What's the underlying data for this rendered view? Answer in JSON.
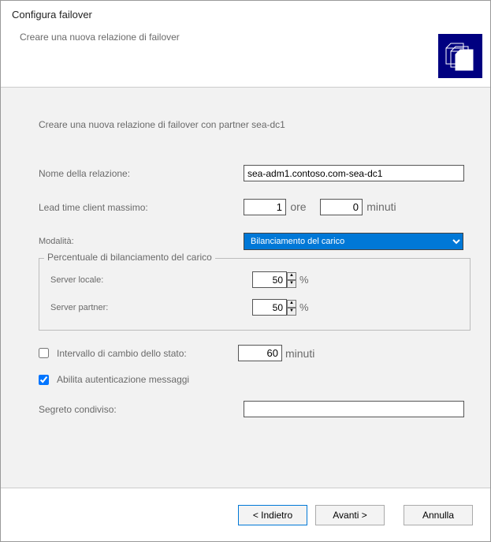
{
  "header": {
    "title": "Configura failover",
    "subtitle": "Creare una nuova relazione di failover"
  },
  "body": {
    "intro": "Creare una nuova relazione di failover con partner sea-dc1",
    "relation_name_label": "Nome della relazione:",
    "relation_name_value": "sea-adm1.contoso.com-sea-dc1",
    "lead_time_label": "Lead time client massimo:",
    "lead_time_hours": "1",
    "lead_time_hours_unit": "ore",
    "lead_time_minutes": "0",
    "lead_time_minutes_unit": "minuti",
    "mode_label": "Modalità:",
    "mode_value": "Bilanciamento del carico",
    "mode_options": [
      "Bilanciamento del carico"
    ],
    "fieldset": {
      "legend": "Percentuale di bilanciamento del carico",
      "local_label": "Server locale:",
      "local_value": "50",
      "partner_label": "Server partner:",
      "partner_value": "50",
      "pct": "%"
    },
    "state_switch_label": "Intervallo di cambio dello stato:",
    "state_switch_checked": false,
    "state_switch_value": "60",
    "state_switch_unit": "minuti",
    "auth_label": "Abilita autenticazione messaggi",
    "auth_checked": true,
    "secret_label": "Segreto condiviso:",
    "secret_value": ""
  },
  "footer": {
    "back": "< Indietro",
    "next": "Avanti >",
    "cancel": "Annulla"
  }
}
